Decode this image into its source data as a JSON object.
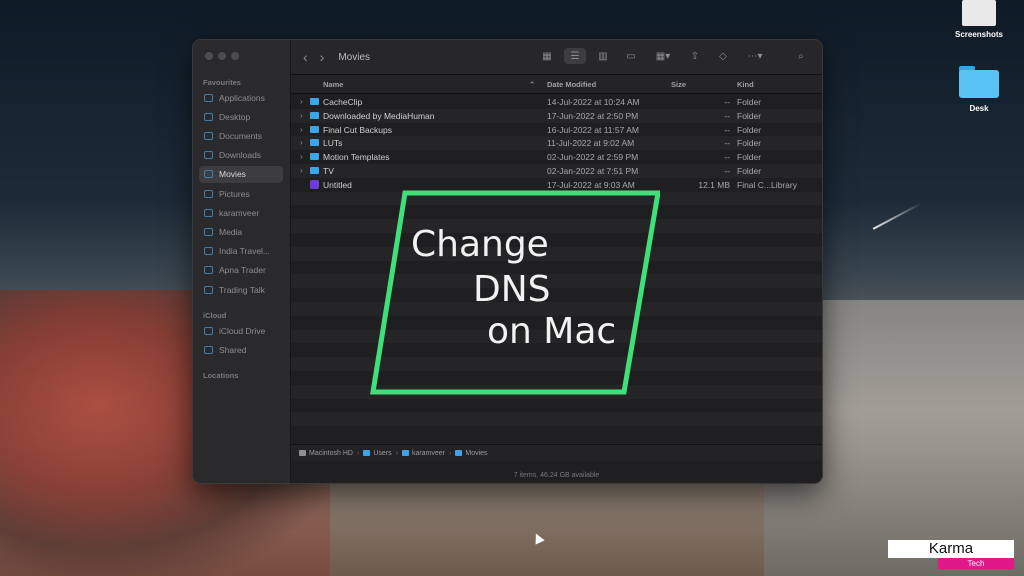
{
  "desktop": {
    "icons": [
      {
        "label": "Screenshots",
        "type": "document"
      },
      {
        "label": "Desk",
        "type": "folder"
      }
    ]
  },
  "finder": {
    "title": "Movies",
    "sidebar": {
      "favourites_label": "Favourites",
      "favourites": [
        {
          "label": "Applications",
          "icon": "applications-icon"
        },
        {
          "label": "Desktop",
          "icon": "desktop-icon"
        },
        {
          "label": "Documents",
          "icon": "documents-icon"
        },
        {
          "label": "Downloads",
          "icon": "downloads-icon"
        },
        {
          "label": "Movies",
          "icon": "movies-icon",
          "active": true
        },
        {
          "label": "Pictures",
          "icon": "pictures-icon"
        },
        {
          "label": "karamveer",
          "icon": "home-icon"
        },
        {
          "label": "Media",
          "icon": "folder-icon"
        },
        {
          "label": "India Travel...",
          "icon": "folder-icon"
        },
        {
          "label": "Apna Trader",
          "icon": "folder-icon"
        },
        {
          "label": "Trading Talk",
          "icon": "folder-icon"
        }
      ],
      "icloud_label": "iCloud",
      "icloud": [
        {
          "label": "iCloud Drive",
          "icon": "cloud-icon"
        },
        {
          "label": "Shared",
          "icon": "shared-folder-icon"
        }
      ],
      "locations_label": "Locations"
    },
    "columns": {
      "name": "Name",
      "date": "Date Modified",
      "size": "Size",
      "kind": "Kind"
    },
    "files": [
      {
        "name": "CacheClip",
        "date": "14-Jul-2022 at 10:24 AM",
        "size": "--",
        "kind": "Folder",
        "type": "folder"
      },
      {
        "name": "Downloaded by MediaHuman",
        "date": "17-Jun-2022 at 2:50 PM",
        "size": "--",
        "kind": "Folder",
        "type": "folder"
      },
      {
        "name": "Final Cut Backups",
        "date": "16-Jul-2022 at 11:57 AM",
        "size": "--",
        "kind": "Folder",
        "type": "folder"
      },
      {
        "name": "LUTs",
        "date": "11-Jul-2022 at 9:02 AM",
        "size": "--",
        "kind": "Folder",
        "type": "folder"
      },
      {
        "name": "Motion Templates",
        "date": "02-Jun-2022 at 2:59 PM",
        "size": "--",
        "kind": "Folder",
        "type": "folder"
      },
      {
        "name": "TV",
        "date": "02-Jan-2022 at 7:51 PM",
        "size": "--",
        "kind": "Folder",
        "type": "folder"
      },
      {
        "name": "Untitled",
        "date": "17-Jul-2022 at 9:03 AM",
        "size": "12.1 MB",
        "kind": "Final C...Library",
        "type": "library"
      }
    ],
    "path": [
      "Macintosh HD",
      "Users",
      "karamveer",
      "Movies"
    ],
    "status": "7 items, 46.24 GB available"
  },
  "overlay": {
    "lines": [
      "Change",
      "DNS",
      "on Mac"
    ],
    "frame_color": "#3fe07a"
  },
  "badge": {
    "title": "Karma",
    "subtitle": "Tech",
    "accent": "#e0188a"
  }
}
